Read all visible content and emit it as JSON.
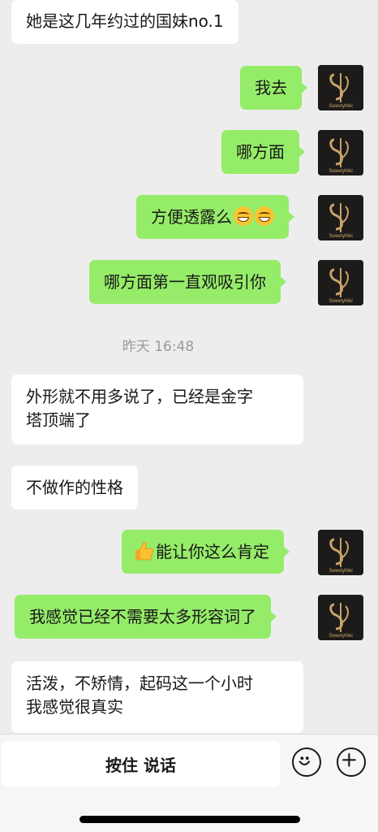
{
  "messages": [
    {
      "id": "m1",
      "side": "left",
      "text": "她是这几年约过的国妹no.1"
    },
    {
      "id": "m2",
      "side": "right",
      "text": "我去"
    },
    {
      "id": "m3",
      "side": "right",
      "text": "哪方面"
    },
    {
      "id": "m4",
      "side": "right",
      "text": "方便透露么",
      "emoji_count": 2
    },
    {
      "id": "m5",
      "side": "right",
      "text": "哪方面第一直观吸引你"
    },
    {
      "id": "m6",
      "side": "left",
      "lines": [
        "外形就不用多说了，已经是金字",
        "塔顶端了"
      ]
    },
    {
      "id": "m7",
      "side": "left",
      "text": "不做作的性格"
    },
    {
      "id": "m8",
      "side": "right",
      "text": "能让你这么肯定",
      "prefix_icon": "thumbs-up-icon"
    },
    {
      "id": "m9",
      "side": "right",
      "text": "我感觉已经不需要太多形容词了"
    },
    {
      "id": "m10",
      "side": "left",
      "lines": [
        "活泼，不矫情，起码这一个小时",
        "我感觉很真实"
      ]
    }
  ],
  "timestamp": "昨天 16:48",
  "avatar": {
    "brand_text": "SweetyMei",
    "icon": "ysl-logo-icon"
  },
  "input_bar": {
    "voice_button_label": "按住 说话",
    "emoji_button_icon": "smiley-icon",
    "more_button_icon": "plus-circle-icon"
  },
  "colors": {
    "background": "#ededed",
    "sent_bubble": "#95ec69",
    "received_bubble": "#ffffff"
  }
}
